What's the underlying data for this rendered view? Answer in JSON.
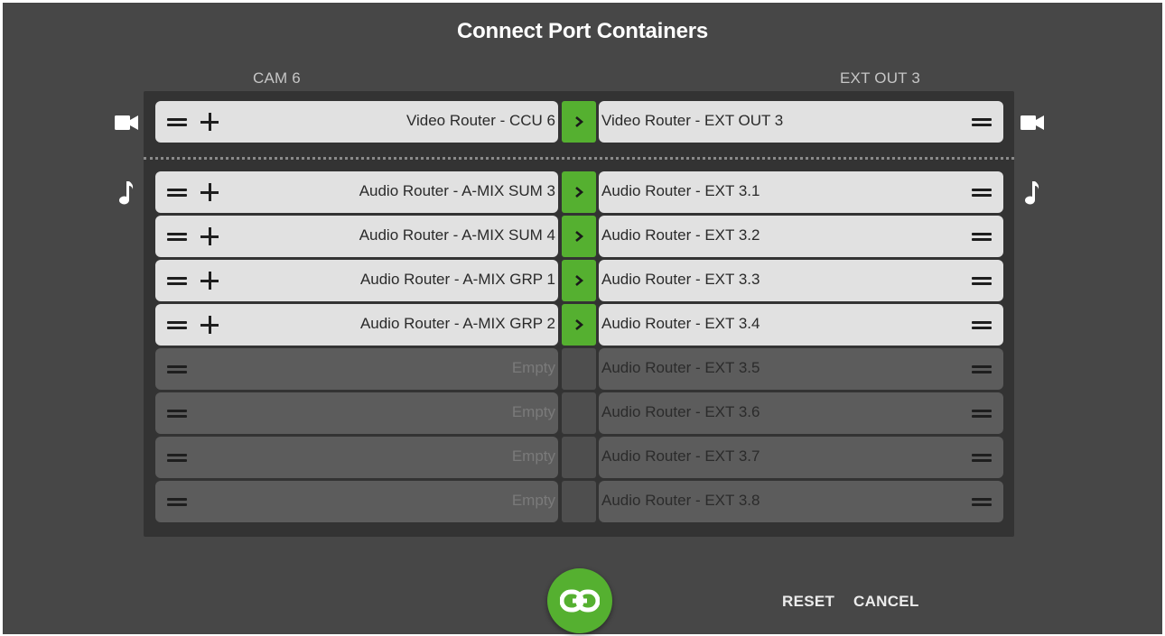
{
  "dialog": {
    "title": "Connect Port Containers",
    "source_label": "CAM 6",
    "destination_label": "EXT OUT 3"
  },
  "groups": {
    "video": {
      "icon": "video-camera-icon",
      "rows": [
        {
          "source": "Video Router - CCU 6",
          "destination": "Video Router - EXT OUT 3",
          "connected": true
        }
      ]
    },
    "audio": {
      "icon": "music-note-icon",
      "rows": [
        {
          "source": "Audio Router - A-MIX SUM 3",
          "destination": "Audio Router - EXT 3.1",
          "connected": true
        },
        {
          "source": "Audio Router - A-MIX SUM 4",
          "destination": "Audio Router - EXT 3.2",
          "connected": true
        },
        {
          "source": "Audio Router - A-MIX GRP 1",
          "destination": "Audio Router - EXT 3.3",
          "connected": true
        },
        {
          "source": "Audio Router - A-MIX GRP 2",
          "destination": "Audio Router - EXT 3.4",
          "connected": true
        },
        {
          "source": "Empty",
          "destination": "Audio Router - EXT 3.5",
          "connected": false
        },
        {
          "source": "Empty",
          "destination": "Audio Router - EXT 3.6",
          "connected": false
        },
        {
          "source": "Empty",
          "destination": "Audio Router - EXT 3.7",
          "connected": false
        },
        {
          "source": "Empty",
          "destination": "Audio Router - EXT 3.8",
          "connected": false
        }
      ]
    }
  },
  "actions": {
    "link_icon": "link-icon",
    "reset_label": "RESET",
    "cancel_label": "CANCEL"
  },
  "colors": {
    "background": "#474747",
    "panel": "#333333",
    "accent_green": "#55b030",
    "filled_row": "#e1e1e1",
    "empty_row": "#5c5c5c"
  }
}
